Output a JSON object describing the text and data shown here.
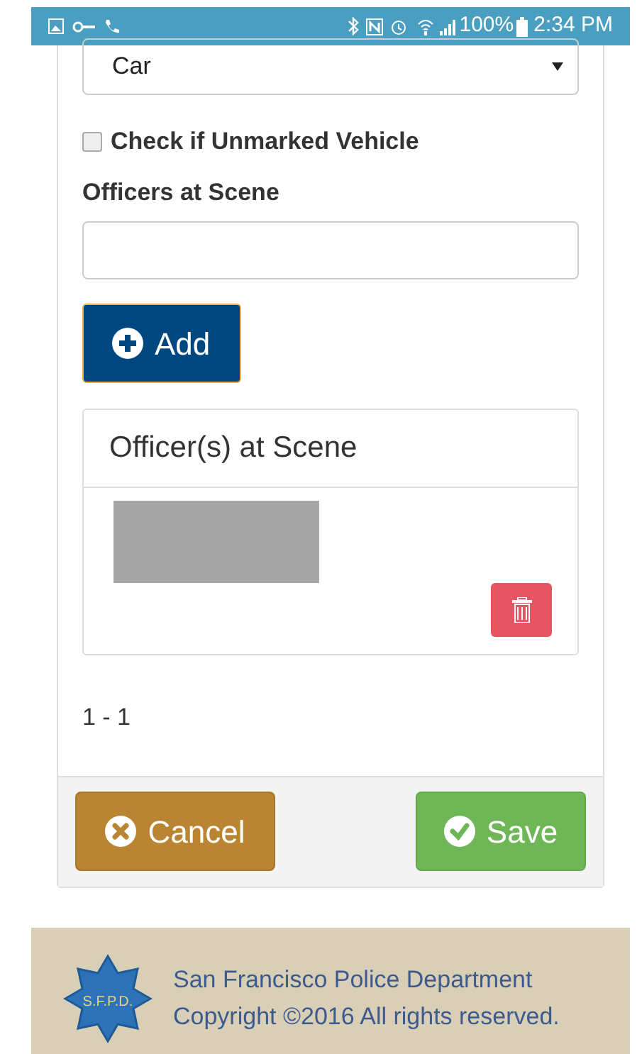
{
  "status_bar": {
    "battery": "100%",
    "time": "2:34 PM"
  },
  "vehicle_select": {
    "value": "Car"
  },
  "unmarked_checkbox": {
    "label": "Check if Unmarked Vehicle",
    "checked": false
  },
  "officers_field": {
    "label": "Officers at Scene"
  },
  "add_button": {
    "label": "Add"
  },
  "officers_panel": {
    "title": "Officer(s) at Scene",
    "rows": [
      {
        "redacted": true
      }
    ]
  },
  "pagination": "1 - 1",
  "buttons": [
    {
      "kind": "cancel",
      "label": "Cancel"
    },
    {
      "kind": "save",
      "label": "Save"
    }
  ],
  "footer": {
    "logo_text": "S.F.P.D.",
    "lines": [
      "San Francisco Police Department",
      "Copyright ©2016 All rights reserved."
    ]
  }
}
